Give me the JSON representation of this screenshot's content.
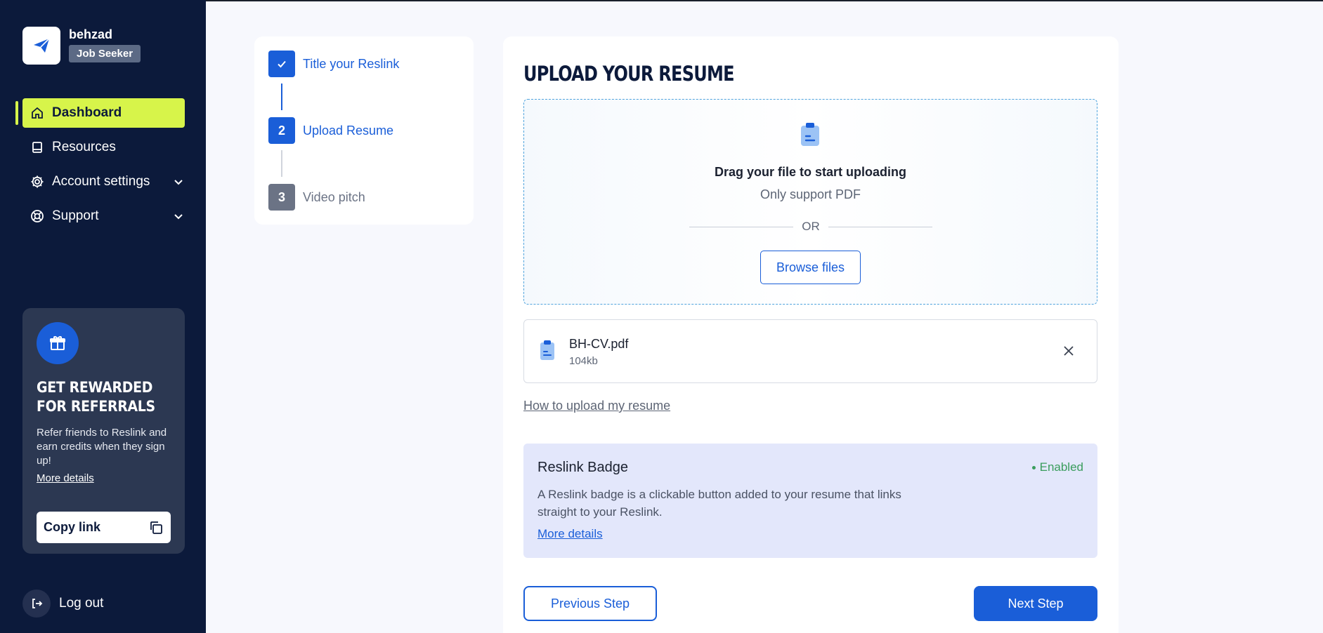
{
  "profile": {
    "name": "behzad",
    "role": "Job Seeker",
    "logo_icon": "paper-plane-icon"
  },
  "nav": {
    "items": [
      {
        "label": "Dashboard",
        "icon": "home-icon",
        "active": true
      },
      {
        "label": "Resources",
        "icon": "book-icon"
      },
      {
        "label": "Account settings",
        "icon": "gear-icon",
        "expandable": true
      },
      {
        "label": "Support",
        "icon": "lifebuoy-icon",
        "expandable": true
      }
    ]
  },
  "referral": {
    "title": "GET REWARDED FOR REFERRALS",
    "description": "Refer friends to Reslink and earn credits when they sign up!",
    "more_label": "More details",
    "copy_label": "Copy link"
  },
  "logout_label": "Log out",
  "steps": [
    {
      "number": "",
      "label": "Title your Reslink",
      "state": "done"
    },
    {
      "number": "2",
      "label": "Upload Resume",
      "state": "current"
    },
    {
      "number": "3",
      "label": "Video pitch",
      "state": "pending"
    }
  ],
  "upload": {
    "title": "UPLOAD YOUR RESUME",
    "drop_title": "Drag your file to start uploading",
    "drop_sub": "Only support PDF",
    "or_text": "OR",
    "browse_label": "Browse files"
  },
  "file": {
    "name": "BH-CV.pdf",
    "size": "104kb"
  },
  "how_link": "How to upload my resume",
  "badge": {
    "title": "Reslink Badge",
    "status": "Enabled",
    "description": "A Reslink badge is a clickable button added to your resume that links straight to your Reslink.",
    "more_label": "More details"
  },
  "actions": {
    "prev_label": "Previous Step",
    "next_label": "Next Step"
  },
  "colors": {
    "sidebar": "#0c1a3b",
    "accent": "#1a5ed8",
    "active_nav": "#d7f44a",
    "enabled": "#3a9d5d"
  }
}
